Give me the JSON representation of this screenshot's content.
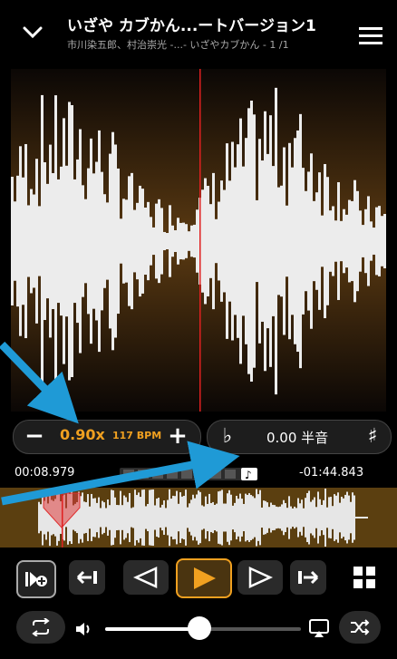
{
  "header": {
    "title": "いざや カブかん...ートバージョン1",
    "subtitle": "市川染五郎、村治崇光 -...- いざやカブかん - 1 /1"
  },
  "speed": {
    "rate": "0.90x",
    "bpm": "117 BPM"
  },
  "pitch": {
    "value": "0.00 半音"
  },
  "time": {
    "elapsed": "00:08.979",
    "remaining": "-01:44.843"
  },
  "colors": {
    "accent": "#f0a020",
    "blue_arrow": "#1f9ad6"
  },
  "volume": {
    "level": 0.48
  }
}
